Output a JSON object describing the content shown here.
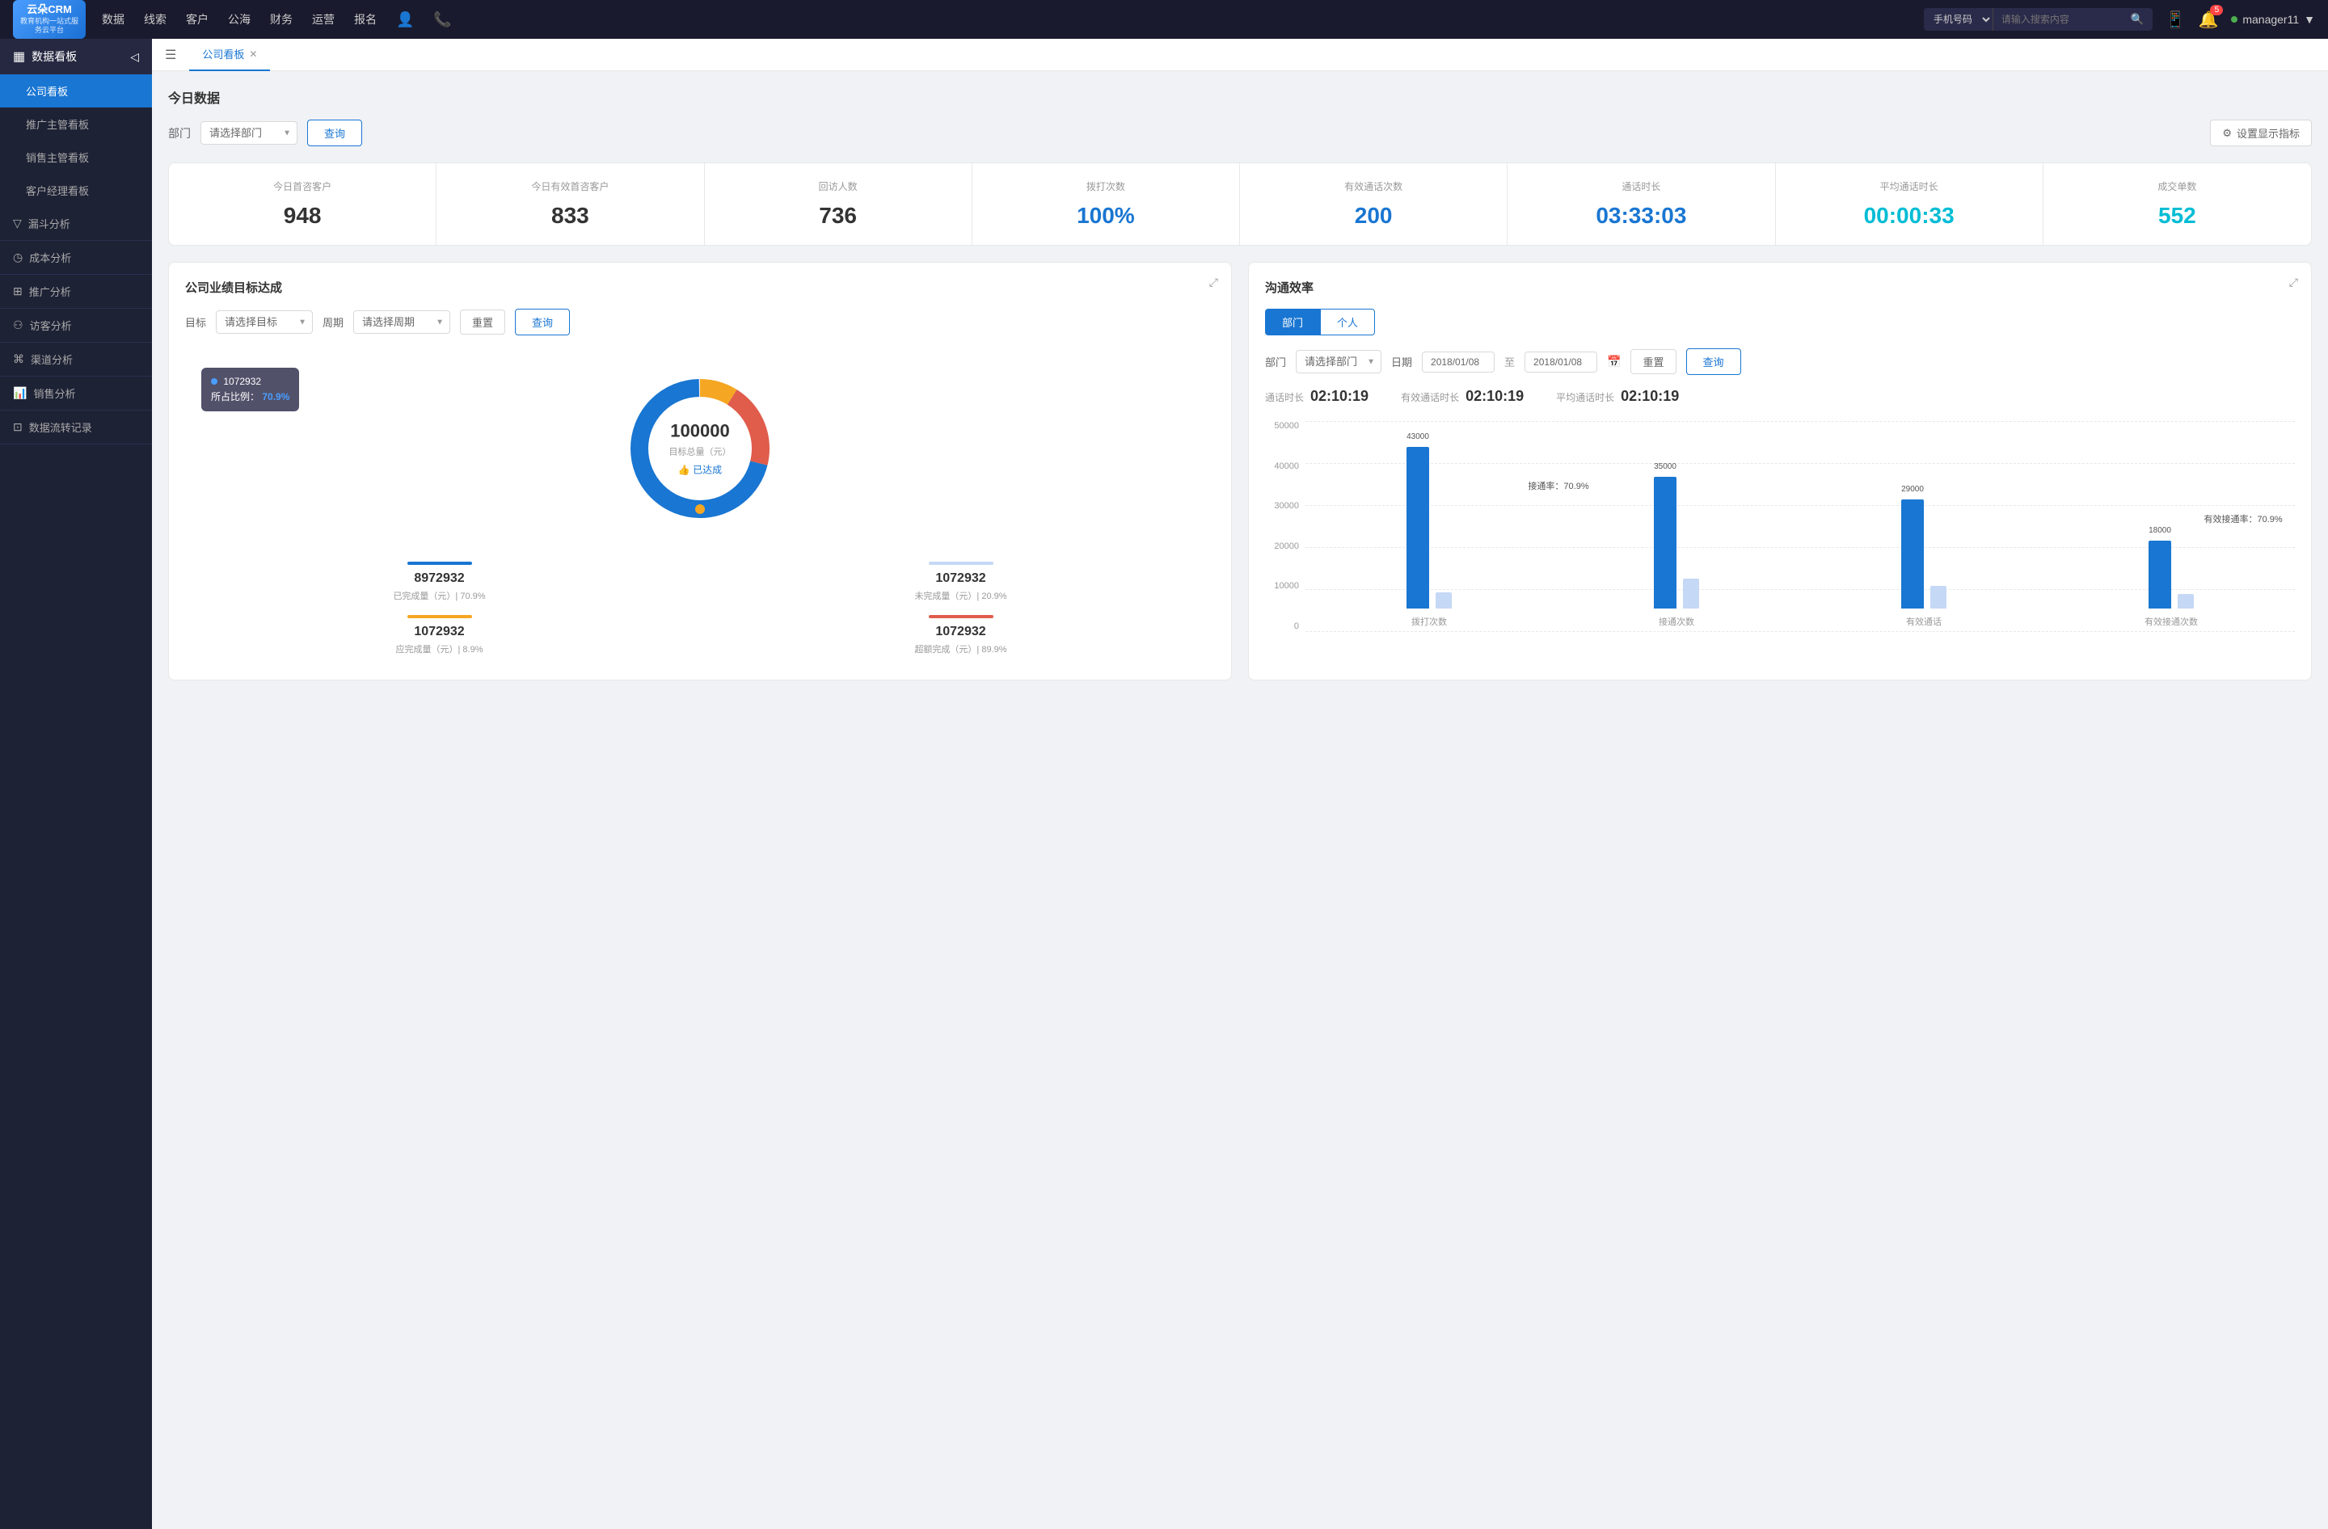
{
  "app": {
    "logo_line1": "云朵CRM",
    "logo_line2": "教育机构一站式服务云平台"
  },
  "topnav": {
    "links": [
      "数据",
      "线索",
      "客户",
      "公海",
      "财务",
      "运营",
      "报名"
    ],
    "search_placeholder": "请输入搜索内容",
    "search_type": "手机号码",
    "notification_count": "5",
    "username": "manager11"
  },
  "sidebar": {
    "section_title": "数据看板",
    "items": [
      {
        "label": "公司看板",
        "active": true
      },
      {
        "label": "推广主管看板",
        "active": false
      },
      {
        "label": "销售主管看板",
        "active": false
      },
      {
        "label": "客户经理看板",
        "active": false
      }
    ],
    "groups": [
      {
        "label": "漏斗分析",
        "icon": "▽"
      },
      {
        "label": "成本分析",
        "icon": "◷"
      },
      {
        "label": "推广分析",
        "icon": "⊞"
      },
      {
        "label": "访客分析",
        "icon": "⚇"
      },
      {
        "label": "渠道分析",
        "icon": "⌘"
      },
      {
        "label": "销售分析",
        "icon": "📊"
      },
      {
        "label": "数据流转记录",
        "icon": "⊡"
      }
    ]
  },
  "tabs": [
    {
      "label": "公司看板",
      "active": true,
      "closable": true
    }
  ],
  "today_section": {
    "title": "今日数据",
    "dept_label": "部门",
    "dept_placeholder": "请选择部门",
    "query_btn": "查询",
    "settings_btn": "设置显示指标"
  },
  "stats": [
    {
      "label": "今日首咨客户",
      "value": "948",
      "color": "black"
    },
    {
      "label": "今日有效首咨客户",
      "value": "833",
      "color": "black"
    },
    {
      "label": "回访人数",
      "value": "736",
      "color": "black"
    },
    {
      "label": "拨打次数",
      "value": "100%",
      "color": "blue"
    },
    {
      "label": "有效通话次数",
      "value": "200",
      "color": "blue"
    },
    {
      "label": "通话时长",
      "value": "03:33:03",
      "color": "blue"
    },
    {
      "label": "平均通话时长",
      "value": "00:00:33",
      "color": "cyan"
    },
    {
      "label": "成交单数",
      "value": "552",
      "color": "cyan"
    }
  ],
  "goal_card": {
    "title": "公司业绩目标达成",
    "target_label": "目标",
    "target_placeholder": "请选择目标",
    "period_label": "周期",
    "period_placeholder": "请选择周期",
    "reset_btn": "重置",
    "query_btn": "查询",
    "donut": {
      "center_value": "100000",
      "center_label": "目标总量（元）",
      "achieved_label": "👍 已达成",
      "tooltip_label": "1072932",
      "tooltip_ratio_label": "所占比例：",
      "tooltip_ratio": "70.9%"
    },
    "stats": [
      {
        "label": "已完成量（元）| 70.9%",
        "value": "8972932",
        "bar_color": "#1976d2"
      },
      {
        "label": "未完成量（元）| 20.9%",
        "value": "1072932",
        "bar_color": "#c5d8f5"
      },
      {
        "label": "应完成量（元）| 8.9%",
        "value": "1072932",
        "bar_color": "#f5a623"
      },
      {
        "label": "超额完成（元）| 89.9%",
        "value": "1072932",
        "bar_color": "#e05c4b"
      }
    ]
  },
  "comm_card": {
    "title": "沟通效率",
    "dept_tab": "部门",
    "personal_tab": "个人",
    "dept_label": "部门",
    "dept_placeholder": "请选择部门",
    "date_label": "日期",
    "date_start": "2018/01/08",
    "date_end": "2018/01/08",
    "reset_btn": "重置",
    "query_btn": "查询",
    "stats": [
      {
        "label": "通话时长",
        "value": "02:10:19"
      },
      {
        "label": "有效通话时长",
        "value": "02:10:19"
      },
      {
        "label": "平均通话时长",
        "value": "02:10:19"
      }
    ],
    "chart": {
      "y_labels": [
        "50000",
        "40000",
        "30000",
        "20000",
        "10000",
        "0"
      ],
      "groups": [
        {
          "x_label": "拨打次数",
          "bars": [
            {
              "value": 43000,
              "height_pct": 86,
              "label": "43000",
              "color": "blue"
            },
            {
              "value": 5000,
              "height_pct": 10,
              "label": "",
              "color": "light"
            }
          ]
        },
        {
          "x_label": "接通次数",
          "annotation": "接通率：70.9%",
          "bars": [
            {
              "value": 35000,
              "height_pct": 70,
              "label": "35000",
              "color": "blue"
            },
            {
              "value": 8000,
              "height_pct": 16,
              "label": "",
              "color": "light"
            }
          ]
        },
        {
          "x_label": "有效通话",
          "bars": [
            {
              "value": 29000,
              "height_pct": 58,
              "label": "29000",
              "color": "blue"
            },
            {
              "value": 6000,
              "height_pct": 12,
              "label": "",
              "color": "light"
            }
          ]
        },
        {
          "x_label": "有效接通次数",
          "annotation": "有效接通率：70.9%",
          "bars": [
            {
              "value": 18000,
              "height_pct": 36,
              "label": "18000",
              "color": "blue"
            },
            {
              "value": 4000,
              "height_pct": 8,
              "label": "",
              "color": "light"
            }
          ]
        }
      ]
    }
  }
}
